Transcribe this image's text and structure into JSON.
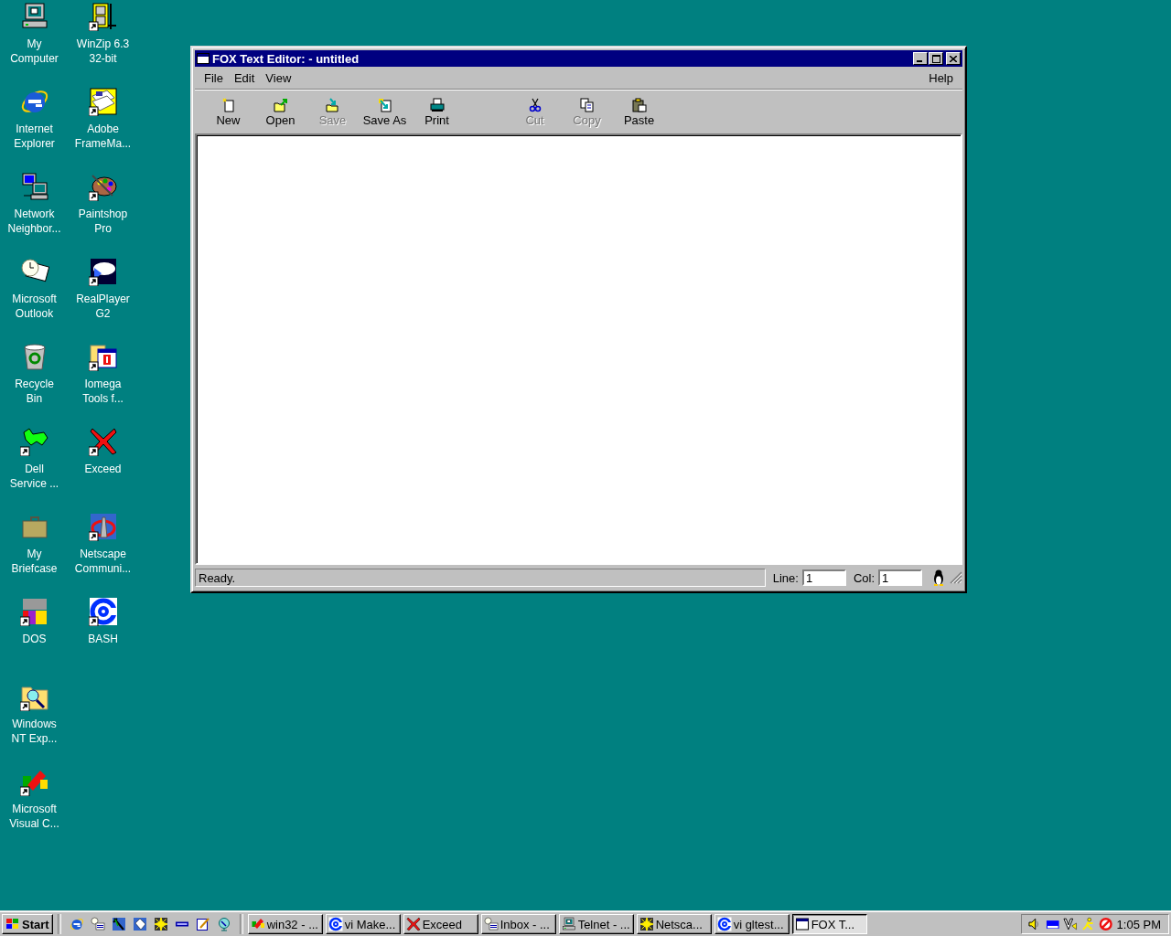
{
  "desktop": {
    "columns": [
      [
        {
          "kind": "computer",
          "shortcut": false,
          "label_lines": [
            "My",
            "Computer"
          ]
        },
        {
          "kind": "browser",
          "shortcut": false,
          "label_lines": [
            "Internet",
            "Explorer"
          ]
        },
        {
          "kind": "network",
          "shortcut": false,
          "label_lines": [
            "Network",
            "Neighbor..."
          ]
        },
        {
          "kind": "mail-clock",
          "shortcut": false,
          "label_lines": [
            "Microsoft",
            "Outlook"
          ]
        },
        {
          "kind": "recycle",
          "shortcut": false,
          "label_lines": [
            "Recycle",
            "Bin"
          ]
        },
        {
          "kind": "wrench",
          "shortcut": true,
          "label_lines": [
            "Dell",
            "Service ..."
          ]
        },
        {
          "kind": "briefcase",
          "shortcut": false,
          "label_lines": [
            "My",
            "Briefcase"
          ]
        },
        {
          "kind": "dos",
          "shortcut": true,
          "label_lines": [
            "DOS"
          ]
        },
        {
          "kind": "folder-search",
          "shortcut": true,
          "label_lines": [
            "Windows",
            "NT Exp..."
          ]
        },
        {
          "kind": "shapes",
          "shortcut": true,
          "label_lines": [
            "Microsoft",
            "Visual C..."
          ]
        }
      ],
      [
        {
          "kind": "archive",
          "shortcut": true,
          "label_lines": [
            "WinZip 6.3",
            "32-bit"
          ]
        },
        {
          "kind": "documents",
          "shortcut": true,
          "label_lines": [
            "Adobe",
            "FrameMa..."
          ]
        },
        {
          "kind": "palette",
          "shortcut": true,
          "label_lines": [
            "Paintshop",
            "Pro"
          ]
        },
        {
          "kind": "media",
          "shortcut": true,
          "label_lines": [
            "RealPlayer",
            "G2"
          ]
        },
        {
          "kind": "calendar",
          "shortcut": true,
          "label_lines": [
            "Iomega",
            "Tools f..."
          ]
        },
        {
          "kind": "x-logo",
          "shortcut": true,
          "label_lines": [
            "Exceed"
          ]
        },
        {
          "kind": "lighthouse",
          "shortcut": true,
          "label_lines": [
            "Netscape",
            "Communi..."
          ]
        },
        {
          "kind": "c-logo",
          "shortcut": true,
          "label_lines": [
            "BASH"
          ]
        }
      ]
    ]
  },
  "window": {
    "title": "FOX Text Editor: - untitled",
    "menus": [
      {
        "label": "File"
      },
      {
        "label": "Edit"
      },
      {
        "label": "View"
      }
    ],
    "right_menus": [
      {
        "label": "Help"
      }
    ],
    "toolbar_groups": [
      [
        {
          "kind": "new",
          "label": "New",
          "disabled": false
        },
        {
          "kind": "open",
          "label": "Open",
          "disabled": false
        },
        {
          "kind": "save",
          "label": "Save",
          "disabled": true
        },
        {
          "kind": "save-as",
          "label": "Save As",
          "disabled": false
        },
        {
          "kind": "print",
          "label": "Print",
          "disabled": false
        }
      ],
      [
        {
          "kind": "cut",
          "label": "Cut",
          "disabled": true
        },
        {
          "kind": "copy",
          "label": "Copy",
          "disabled": true
        },
        {
          "kind": "paste",
          "label": "Paste",
          "disabled": false
        }
      ]
    ],
    "status_bar": {
      "message": "Ready.",
      "line_label": "Line:",
      "line_value": "1",
      "col_label": "Col:",
      "col_value": "1"
    }
  },
  "taskbar": {
    "start": "Start",
    "quick_launch": [
      {
        "kind": "browser"
      },
      {
        "kind": "inbox"
      },
      {
        "kind": "pointer"
      },
      {
        "kind": "tag"
      },
      {
        "kind": "star"
      },
      {
        "kind": "dell"
      },
      {
        "kind": "notepad"
      },
      {
        "kind": "globe"
      }
    ],
    "tasks": [
      {
        "kind": "shapes",
        "label": "win32 - ...",
        "selected": false
      },
      {
        "kind": "c-logo",
        "label": "vi Make...",
        "selected": false
      },
      {
        "kind": "x-logo",
        "label": "Exceed",
        "selected": false
      },
      {
        "kind": "inbox",
        "label": "Inbox - ...",
        "selected": false
      },
      {
        "kind": "computer",
        "label": "Telnet - ...",
        "selected": false
      },
      {
        "kind": "star",
        "label": "Netsca...",
        "selected": false
      },
      {
        "kind": "c-logo",
        "label": "vi gltest...",
        "selected": false
      },
      {
        "kind": "window",
        "label": "FOX T...",
        "selected": true
      }
    ],
    "tray": [
      {
        "kind": "speaker"
      },
      {
        "kind": "nic"
      },
      {
        "kind": "v-mark"
      },
      {
        "kind": "person"
      },
      {
        "kind": "no-sign"
      }
    ],
    "clock": "1:05 PM"
  }
}
